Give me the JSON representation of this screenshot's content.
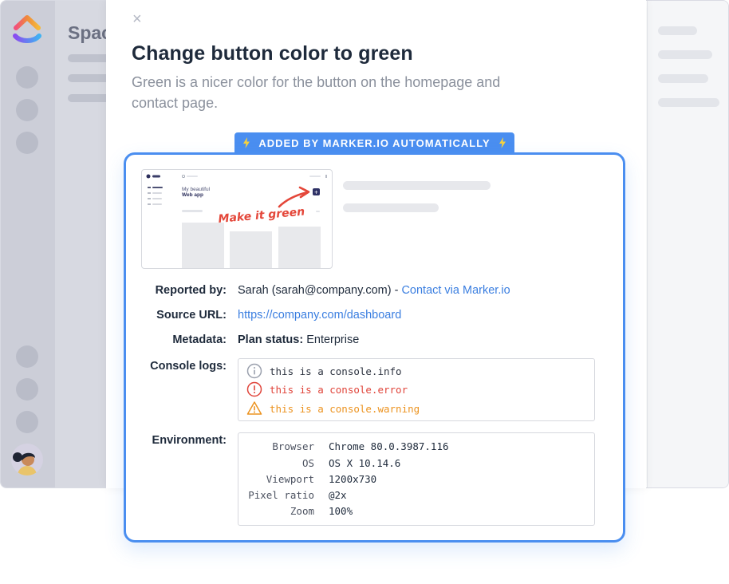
{
  "background_app": {
    "space_title": "Space"
  },
  "modal": {
    "close_symbol": "×",
    "title": "Change button color to green",
    "description": "Green is a nicer color for the button on the homepage and contact page."
  },
  "marker": {
    "badge": "ADDED BY MARKER.IO AUTOMATICALLY",
    "accent_color": "#4a8ef0",
    "screenshot": {
      "app_title_line1": "My beautiful",
      "app_title_line2": "Web app",
      "annotation": "Make it green",
      "annotation_color": "#e4473a",
      "button_symbol": "+"
    },
    "reported_by": {
      "label": "Reported by:",
      "value": "Sarah (sarah@company.com) - ",
      "link": "Contact via Marker.io"
    },
    "source_url": {
      "label": "Source URL:",
      "value": "https://company.com/dashboard"
    },
    "metadata": {
      "label": "Metadata:",
      "key": "Plan status:",
      "value": " Enterprise"
    },
    "console": {
      "label": "Console logs:",
      "logs": [
        {
          "type": "info",
          "icon": "info-icon",
          "text": "this is a console.info",
          "color": "#2d3340"
        },
        {
          "type": "error",
          "icon": "error-icon",
          "text": "this is a console.error",
          "color": "#e0443a"
        },
        {
          "type": "warning",
          "icon": "warning-icon",
          "text": "this is a console.warning",
          "color": "#ec9320"
        }
      ]
    },
    "environment": {
      "label": "Environment:",
      "rows": [
        {
          "key": "Browser",
          "value": "Chrome 80.0.3987.116"
        },
        {
          "key": "OS",
          "value": "OS X 10.14.6"
        },
        {
          "key": "Viewport",
          "value": "1200x730"
        },
        {
          "key": "Pixel ratio",
          "value": "@2x"
        },
        {
          "key": "Zoom",
          "value": "100%"
        }
      ]
    }
  }
}
